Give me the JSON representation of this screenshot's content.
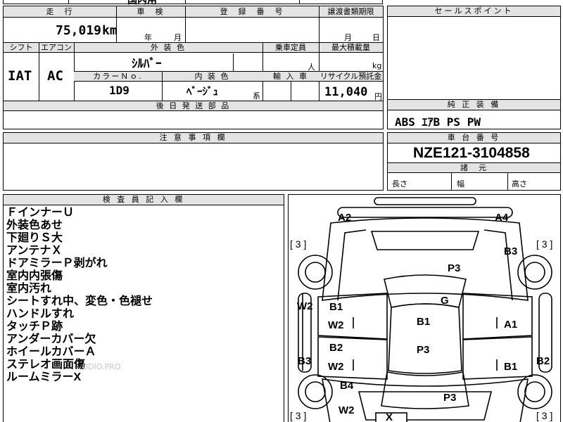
{
  "top_strip": {
    "cut_text": "国内用"
  },
  "mileage": {
    "header": "走　行",
    "value": "75,019",
    "unit": "km"
  },
  "inspection": {
    "header": "車　検",
    "year_label": "年",
    "month_label": "月"
  },
  "registration": {
    "header": "登　録　番　号"
  },
  "transfer": {
    "header": "譲渡書類期限",
    "month_label": "月",
    "day_label": "日"
  },
  "sales_points": {
    "header": "セールスポイント"
  },
  "shift": {
    "header": "シフト",
    "value": "IAT"
  },
  "aircon": {
    "header": "エアコン",
    "value": "AC"
  },
  "exterior_color": {
    "header": "外 装 色",
    "value": "ｼﾙﾊﾞｰ"
  },
  "capacity": {
    "header": "乗車定員",
    "unit": "人"
  },
  "max_load": {
    "header": "最大積載量",
    "unit": "kg"
  },
  "color_no": {
    "header": "カラーＮｏ.",
    "value": "1D9"
  },
  "interior_color": {
    "header": "内 装 色",
    "value": "ﾍﾞｰｼﾞｭ",
    "suffix": "系"
  },
  "import": {
    "header": "輸 入 車"
  },
  "recycle": {
    "header": "リサイクル預託金",
    "value": "11,040",
    "unit": "円"
  },
  "later_parts": {
    "header": "後 日 発 送 部 品"
  },
  "standard_equipment": {
    "header": "純 正 装 備",
    "value": "ABS ｴｱB PS PW"
  },
  "caution": {
    "header": "注 意 事 項 欄"
  },
  "chassis": {
    "header": "車 台 番 号",
    "value": "NZE121-3104858"
  },
  "dimensions": {
    "header": "諸　元",
    "length": "長さ",
    "width": "幅",
    "height": "高さ"
  },
  "inspector": {
    "header": "検 査 員 記 入 欄",
    "notes": [
      "ＦインナーＵ",
      "外装色あせ",
      "下廻りＳ大",
      "アンテナＸ",
      "ドアミラーＰ剥がれ",
      "室内内張傷",
      "室内汚れ",
      "シートすれ中、変色・色褪せ",
      "ハンドルすれ",
      "タッチＰ跡",
      "アンダーカバー欠",
      "ホイールカバーＡ",
      "ステレオ画面傷",
      "ルームミラーX"
    ],
    "watermark": "UDIO.PRO"
  },
  "diagram": {
    "marks": {
      "a2_top_left": "A2",
      "a4_top_right": "A4",
      "b3_front_right": "B3",
      "p3_hood": "P3",
      "w2_left_front": "W2",
      "b1_left_front_door": "B1",
      "w2_left_front_door": "W2",
      "g_windshield": "G",
      "b1_roof": "B1",
      "a1_right_front_door": "A1",
      "b2_left_rear_door": "B2",
      "w2_left_rear_door": "W2",
      "p3_roof": "P3",
      "b3_left_rear": "B3",
      "b1_right_rear_door": "B1",
      "b2_right_rear": "B2",
      "b4_left_rear_wheel": "B4",
      "p3_trunk": "P3",
      "w2_left_rear": "W2",
      "x_rear": "X"
    },
    "tire_tl": "[ 3 ]",
    "tire_tr": "[ 3 ]",
    "tire_bl": "[ 3 ]",
    "tire_br": "[ 3 ]"
  }
}
